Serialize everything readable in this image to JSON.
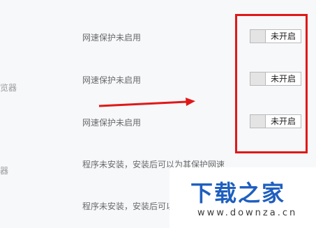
{
  "left_edge_labels": [
    "览器",
    "器"
  ],
  "rows": [
    {
      "label": "网速保护未启用",
      "toggle_state": "未开启"
    },
    {
      "label": "网速保护未启用",
      "toggle_state": "未开启"
    },
    {
      "label": "网速保护未启用",
      "toggle_state": "未开启"
    },
    {
      "label": "程序未安装，安装后可以为其保护网速"
    },
    {
      "label": "程序未安装，安装后可以为其保护网速"
    }
  ],
  "watermark": {
    "title": "下载之家",
    "url": "www.downza.cn"
  },
  "colors": {
    "annotation_red": "#e01818",
    "watermark_blue": "#1f5fbf"
  }
}
